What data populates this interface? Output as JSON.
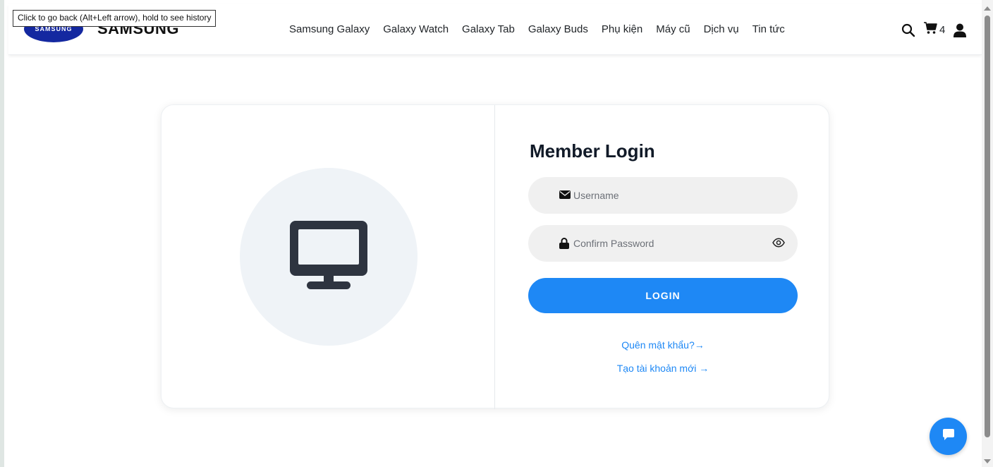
{
  "tooltip": "Click to go back (Alt+Left arrow), hold to see history",
  "brand": {
    "oval_text": "SAMSUNG",
    "wordmark": "SAMSUNG",
    "color": "#1428a0"
  },
  "nav": {
    "links": [
      "Samsung Galaxy",
      "Galaxy Watch",
      "Galaxy Tab",
      "Galaxy Buds",
      "Phụ kiện",
      "Máy cũ",
      "Dịch vụ",
      "Tin tức"
    ],
    "cart_count": "4",
    "icons": [
      "search-icon",
      "cart-icon",
      "user-icon"
    ]
  },
  "login": {
    "title": "Member Login",
    "username_placeholder": "Username",
    "password_placeholder": "Confirm Password",
    "button_label": "LOGIN",
    "forgot_link": "Quên mật khẩu?→",
    "register_link": "Tạo tài khoản mới →"
  },
  "illustration": {
    "icon": "desktop-monitor-icon"
  },
  "colors": {
    "accent": "#1e88f5",
    "title": "#111a28",
    "field_bg": "#f0f0f0",
    "circle_bg": "#eff3f7"
  }
}
